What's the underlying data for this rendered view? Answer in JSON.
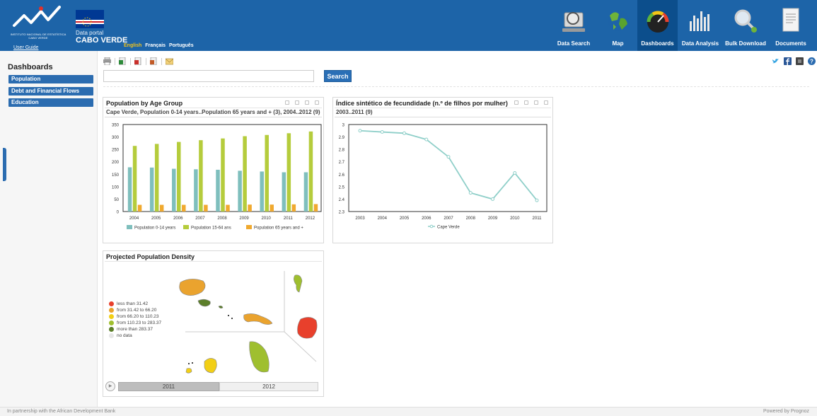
{
  "header": {
    "org_name": "INSTITUTO NACIONAL DE ESTATÍSTICA CABO VERDE",
    "portal_small": "Data portal",
    "portal_big": "CABO VERDE",
    "user_guide": "User Guide",
    "languages": [
      "English",
      "Français",
      "Português"
    ],
    "current_language": "English"
  },
  "nav": [
    {
      "label": "Data Search",
      "icon": "magnifier-computer-icon",
      "active": false
    },
    {
      "label": "Map",
      "icon": "globe-icon",
      "active": false
    },
    {
      "label": "Dashboards",
      "icon": "gauge-icon",
      "active": true
    },
    {
      "label": "Data Analysis",
      "icon": "bar-chart-icon",
      "active": false
    },
    {
      "label": "Bulk Download",
      "icon": "download-magnifier-icon",
      "active": false
    },
    {
      "label": "Documents",
      "icon": "document-icon",
      "active": false
    }
  ],
  "toolbar": {
    "icons": [
      "print-icon",
      "export-excel-icon",
      "export-pdf-icon",
      "export-csv-icon",
      "email-icon"
    ],
    "social": [
      "twitter-icon",
      "facebook-icon",
      "share-icon",
      "help-icon"
    ]
  },
  "search": {
    "value": "",
    "placeholder": "",
    "button_label": "Search"
  },
  "sidebar": {
    "title": "Dashboards",
    "items": [
      {
        "label": "Population"
      },
      {
        "label": "Debt and Financial Flows"
      },
      {
        "label": "Education"
      }
    ]
  },
  "panels": {
    "population": {
      "title": "Population by Age Group",
      "subtitle": "Cape Verde, Population 0-14 years..Population 65 years and + (3), 2004..2012 (9)"
    },
    "fertility": {
      "title": "Índice sintético de fecundidade (n.º de filhos por mulher)",
      "subtitle": "2003..2011 (9)"
    },
    "map": {
      "title": "Projected Population Density",
      "legend": [
        {
          "label": "less than 31.42",
          "color": "#e8402c"
        },
        {
          "label": "from 31.42 to 66.20",
          "color": "#eaa32e"
        },
        {
          "label": "from 66.20 to 110.23",
          "color": "#f2cf16"
        },
        {
          "label": "from 110.23 to 283.37",
          "color": "#9fbf2f"
        },
        {
          "label": "more than 283.37",
          "color": "#5c7f2a"
        },
        {
          "label": "no data",
          "color": "#e6e6e6"
        }
      ],
      "timeline": [
        "2011",
        "2012"
      ]
    }
  },
  "chart_data": [
    {
      "type": "bar",
      "title": "Population by Age Group",
      "categories": [
        "2004",
        "2005",
        "2006",
        "2007",
        "2008",
        "2009",
        "2010",
        "2011",
        "2012"
      ],
      "ylim": [
        0,
        350
      ],
      "yticks": [
        0,
        50,
        100,
        150,
        200,
        250,
        300,
        350
      ],
      "series": [
        {
          "name": "Population 0-14 years",
          "color": "#7fbfbd",
          "values": [
            178,
            177,
            172,
            170,
            168,
            164,
            161,
            158,
            158
          ]
        },
        {
          "name": "Population 15-64 ans",
          "color": "#b5cc3c",
          "values": [
            264,
            272,
            280,
            287,
            294,
            303,
            308,
            315,
            322
          ]
        },
        {
          "name": "Population 65 years and +",
          "color": "#f0a92f",
          "values": [
            27,
            27,
            27,
            27,
            27,
            28,
            28,
            29,
            30
          ]
        }
      ]
    },
    {
      "type": "line",
      "title": "Índice sintético de fecundidade (n.º de filhos por mulher)",
      "x": [
        "2003",
        "2004",
        "2005",
        "2006",
        "2007",
        "2008",
        "2009",
        "2010",
        "2011"
      ],
      "ylim": [
        2.3,
        3.0
      ],
      "yticks": [
        "2.3",
        "2.4",
        "2.5",
        "2.6",
        "2.7",
        "2.8",
        "2.9",
        "3"
      ],
      "series": [
        {
          "name": "Cape Verde",
          "color": "#8fcfc9",
          "values": [
            2.95,
            2.94,
            2.93,
            2.88,
            2.74,
            2.45,
            2.4,
            2.61,
            2.39
          ]
        }
      ]
    }
  ],
  "footer": {
    "left": "In partnership with the African Development Bank",
    "right": "Powered by Prognoz"
  }
}
